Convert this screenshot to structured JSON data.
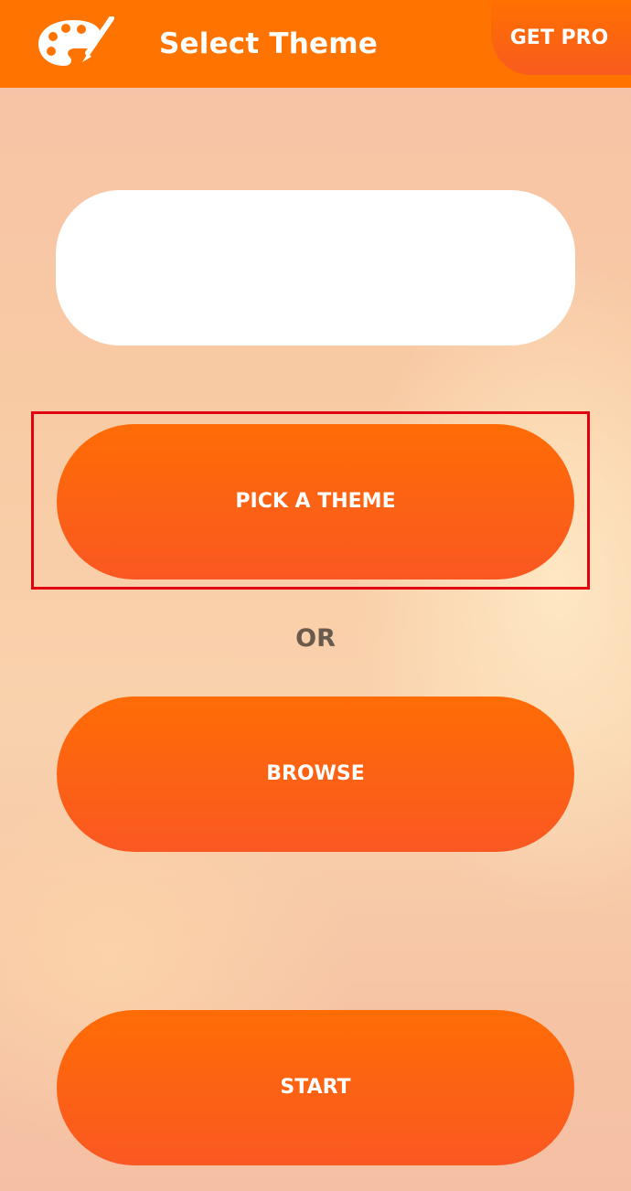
{
  "header": {
    "title": "Select Theme",
    "icon": "palette-icon",
    "get_pro_label": "GET PRO",
    "background_color": "#ff7300"
  },
  "main": {
    "pick_theme_label": "PICK A THEME",
    "or_label": "OR",
    "browse_label": "BROWSE",
    "start_label": "START",
    "button_color": "#fa5f18",
    "highlight_color": "#e0000f"
  }
}
